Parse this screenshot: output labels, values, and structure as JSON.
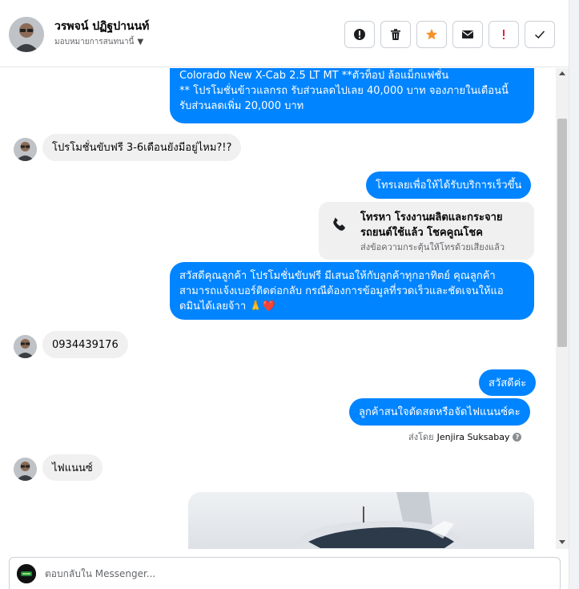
{
  "header": {
    "contact_name": "วรพจน์ ปฏิฐปานนท์",
    "assign_label": "มอบหมายการสนทนานี้",
    "actions": [
      {
        "icon": "alert-circle-icon"
      },
      {
        "icon": "trash-icon"
      },
      {
        "icon": "star-icon",
        "color": "#f5922d"
      },
      {
        "icon": "envelope-icon"
      },
      {
        "icon": "exclamation-icon",
        "color": "#e41e3f"
      },
      {
        "icon": "check-icon"
      }
    ]
  },
  "messages": {
    "m1_line1": "Colorado New X-Cab 2.5 LT MT **ตัวท็อป ล้อแม็กแฟชั่น",
    "m1_line2": "** โปรโมชั่นข้าวแลกรถ รับส่วนลดไปเลย 40,000 บาท จองภายในเดือนนี้",
    "m1_line3": "รับส่วนลดเพิ่ม 20,000 บาท",
    "m2": "โปรโมชั่นขับฟรี 3-6เดือนยังมีอยู่ไหม?!?",
    "m3": "โทรเลยเพื่อให้ได้รับบริการเร็วขึ้น",
    "call_title_line1": "โทรหา โรงงานผลิตและกระจาย",
    "call_title_line2": "รถยนต์ใช้แล้ว โชคคูณโชค",
    "call_sub": "ส่งข้อความกระตุ้นให้โทรด้วยเสียงแล้ว",
    "m4_line1": "สวัสดีคุณลูกค้า โปรโมชั่นขับฟรี มีเสนอให้กับลูกค้าทุกอาทิตย์ คุณลูกค้า",
    "m4_line2": "สามารถแจ้งเบอร์ติดต่อกลับ กรณีต้องการข้อมูลที่รวดเร็วและชัดเจนให้แอ",
    "m4_line3": "ดมินได้เลยจ้าา 🙏❤️",
    "m5": "0934439176",
    "m6": "สวัสดีค่ะ",
    "m7": "ลูกค้าสนใจตัดสดหรือจัดไฟแนนซ์คะ",
    "sent_by_prefix": "ส่งโดย",
    "sent_by_agent": "Jenjira Suksabay",
    "m8": "ไฟแนนซ์"
  },
  "composer": {
    "placeholder": "ตอบกลับใน Messenger..."
  },
  "colors": {
    "outgoing": "#0084ff",
    "incoming": "#f0f0f0"
  }
}
